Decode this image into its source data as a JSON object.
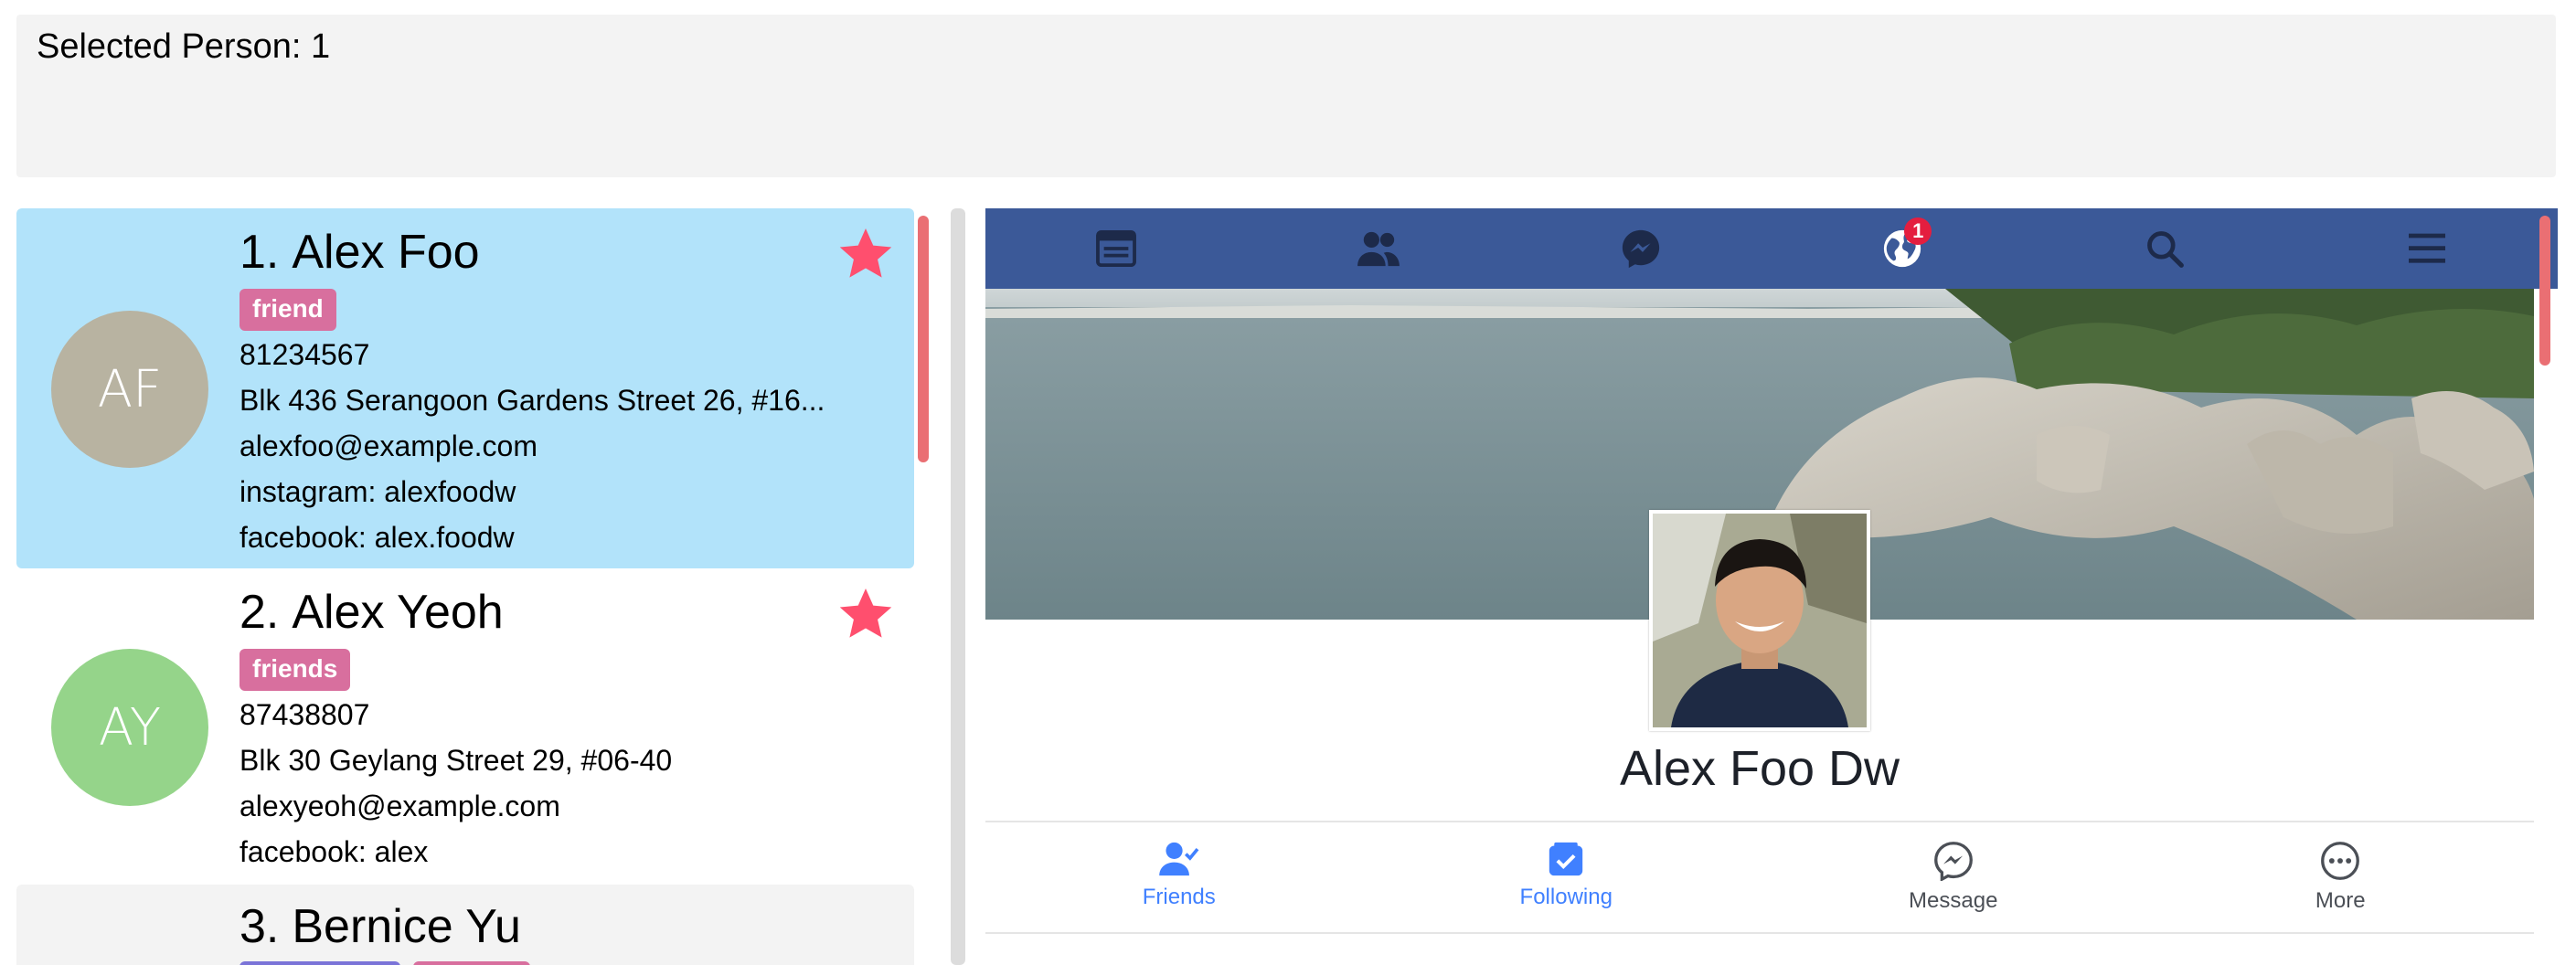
{
  "result": {
    "text": "Selected Person: 1"
  },
  "persons": [
    {
      "index": "1.",
      "name": "Alex Foo",
      "initials": "AF",
      "avatar_color": "#b8b3a1",
      "tags": [
        "friend"
      ],
      "phone": "81234567",
      "address": "Blk 436 Serangoon Gardens Street 26, #16...",
      "email": "alexfoo@example.com",
      "instagram": "instagram: alexfoodw",
      "facebook": "facebook: alex.foodw",
      "favorite": true
    },
    {
      "index": "2.",
      "name": "Alex Yeoh",
      "initials": "AY",
      "avatar_color": "#95d48a",
      "tags": [
        "friends"
      ],
      "phone": "87438807",
      "address": "Blk 30 Geylang Street 29, #06-40",
      "email": "alexyeoh@example.com",
      "facebook": "facebook: alex",
      "favorite": true
    },
    {
      "index": "3.",
      "name": "Bernice Yu"
    }
  ],
  "browser": {
    "nav_icons": [
      "news-feed-icon",
      "friends-icon",
      "messenger-icon",
      "notifications-globe-icon",
      "search-icon",
      "menu-icon"
    ],
    "notification_count": "1",
    "profile_name": "Alex Foo Dw",
    "actions": [
      {
        "label": "Friends",
        "icon": "friend-check-icon",
        "color": "#4080ff"
      },
      {
        "label": "Following",
        "icon": "following-icon",
        "color": "#4080ff"
      },
      {
        "label": "Message",
        "icon": "messenger-icon",
        "color": "#4b4f56"
      },
      {
        "label": "More",
        "icon": "more-icon",
        "color": "#4b4f56"
      }
    ]
  },
  "colors": {
    "fb_blue": "#3b5998",
    "selected_bg": "#b2e3fa",
    "star": "#ff4f6e",
    "tag": "#d86f9e",
    "scrollbar": "#ea6f73"
  }
}
